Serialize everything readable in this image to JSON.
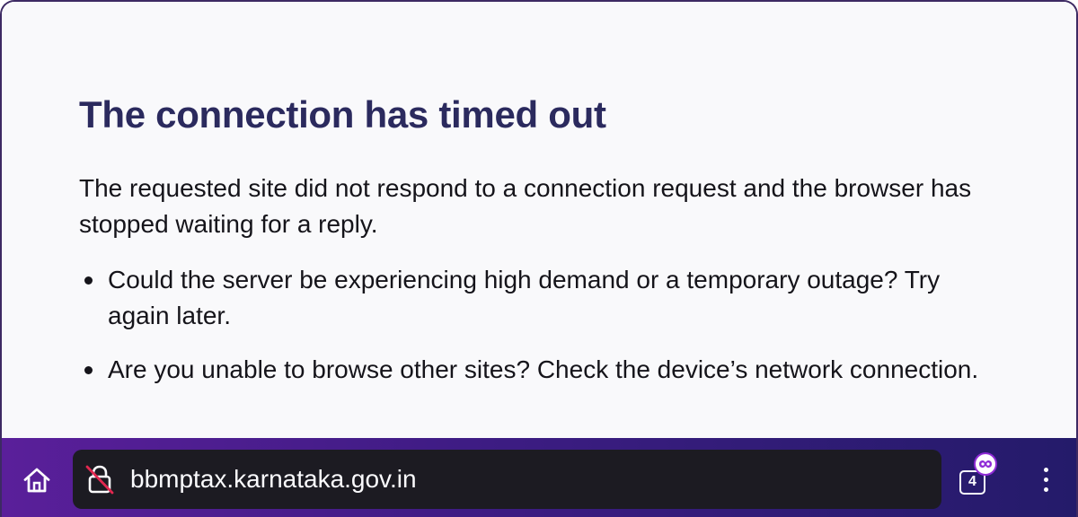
{
  "error": {
    "title": "The connection has timed out",
    "description": "The requested site did not respond to a connection request and the browser has stopped waiting for a reply.",
    "suggestions": [
      "Could the server be experiencing high demand or a temporary outage? Try again later.",
      "Are you unable to browse other sites? Check the device’s network connection."
    ]
  },
  "toolbar": {
    "home_icon": "home-icon",
    "lock_icon": "broken-lock-icon",
    "url": "bbmptax.karnataka.gov.in",
    "tab_count": "4",
    "private_icon": "private-mask-icon",
    "menu_icon": "vertical-dots-icon"
  },
  "colors": {
    "title": "#2b2a5e",
    "body_text": "#15141a",
    "page_background": "#f9f9fb",
    "toolbar_start": "#5a1f9a",
    "toolbar_end": "#241b6a",
    "url_bar": "#1c1b22",
    "private_accent": "#8f2bd6",
    "insecure_slash": "#e22850"
  }
}
